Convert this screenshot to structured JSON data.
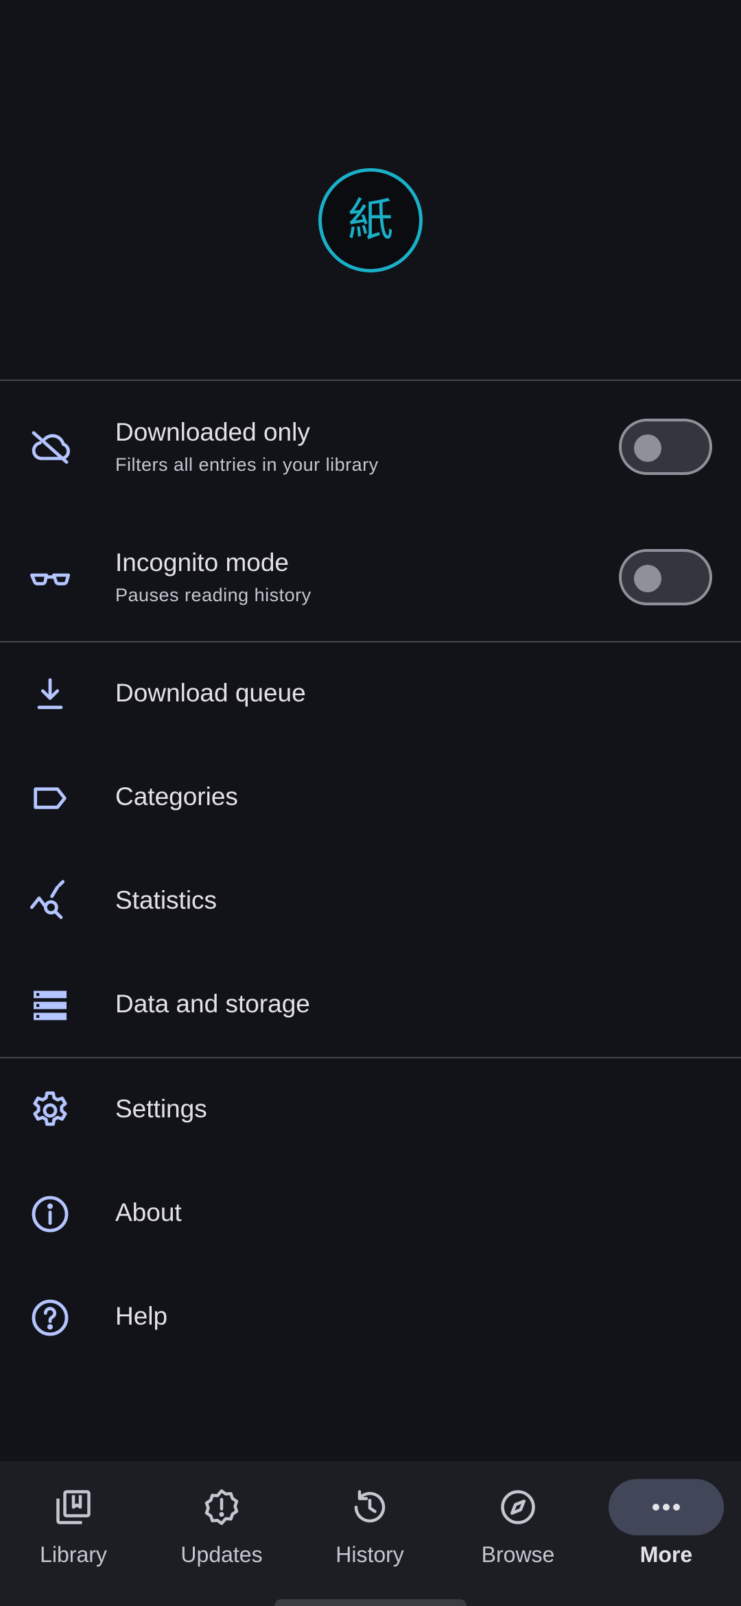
{
  "header": {
    "logo_glyph": "紙",
    "accent_color": "#1ab0c8"
  },
  "toggles": [
    {
      "title": "Downloaded only",
      "subtitle": "Filters all entries in your library",
      "icon": "cloud-off-icon",
      "enabled": false
    },
    {
      "title": "Incognito mode",
      "subtitle": "Pauses reading history",
      "icon": "glasses-icon",
      "enabled": false
    }
  ],
  "menu": {
    "download_queue": "Download queue",
    "categories": "Categories",
    "statistics": "Statistics",
    "data_and_storage": "Data and storage",
    "settings": "Settings",
    "about": "About",
    "help": "Help"
  },
  "nav": {
    "library": "Library",
    "updates": "Updates",
    "history": "History",
    "browse": "Browse",
    "more": "More",
    "active": "More"
  },
  "colors": {
    "background": "#121318",
    "icon": "#b4c5ff",
    "navbar": "#1d1e24",
    "active_pill": "#414659"
  }
}
